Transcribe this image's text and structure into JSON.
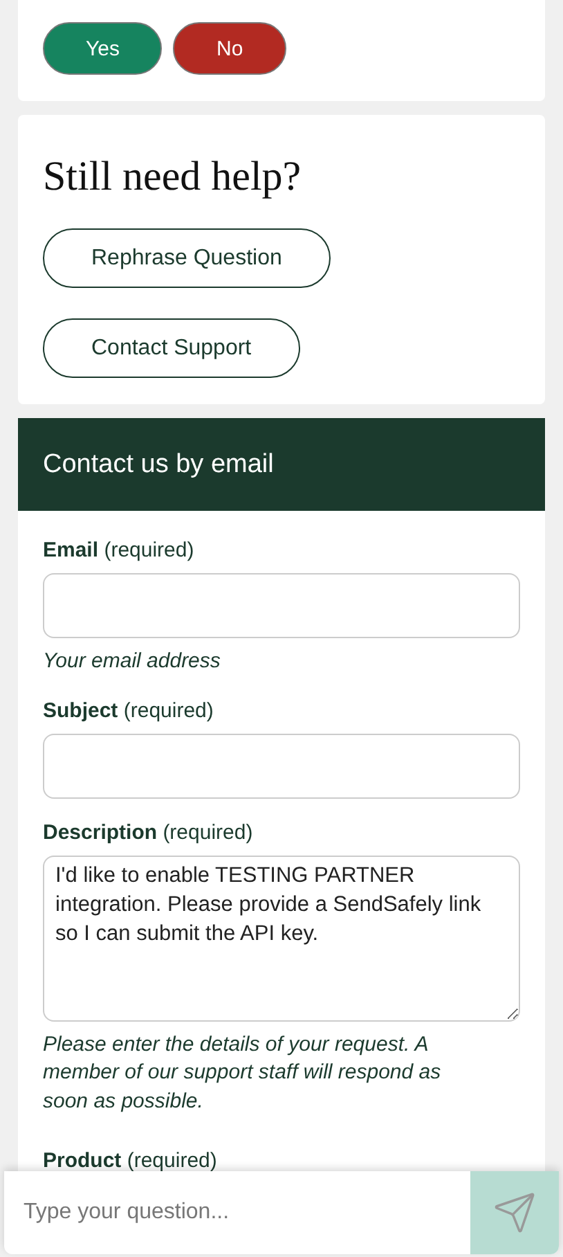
{
  "feedback": {
    "buttons": [
      {
        "label": "Yes",
        "kind": "yes"
      },
      {
        "label": "No",
        "kind": "no"
      }
    ]
  },
  "help": {
    "title": "Still need help?",
    "buttons": [
      "Rephrase Question",
      "Contact Support"
    ]
  },
  "contact": {
    "header": "Contact us by email",
    "fields": [
      {
        "label": "Email",
        "note": "(required)",
        "kind": "input",
        "hint": "Your email address"
      },
      {
        "label": "Subject",
        "note": "(required)",
        "kind": "input"
      },
      {
        "label": "Description",
        "note": "(required)",
        "kind": "textarea",
        "value": "I'd like to enable TESTING PARTNER integration. Please provide a SendSafely link so I can submit the API key.",
        "hint": "Please enter the details of your request. A member of our support staff will respond as soon as possible."
      },
      {
        "label": "Product",
        "note": "(required)",
        "kind": "label"
      }
    ]
  },
  "chat": {
    "placeholder": "Type your question..."
  }
}
